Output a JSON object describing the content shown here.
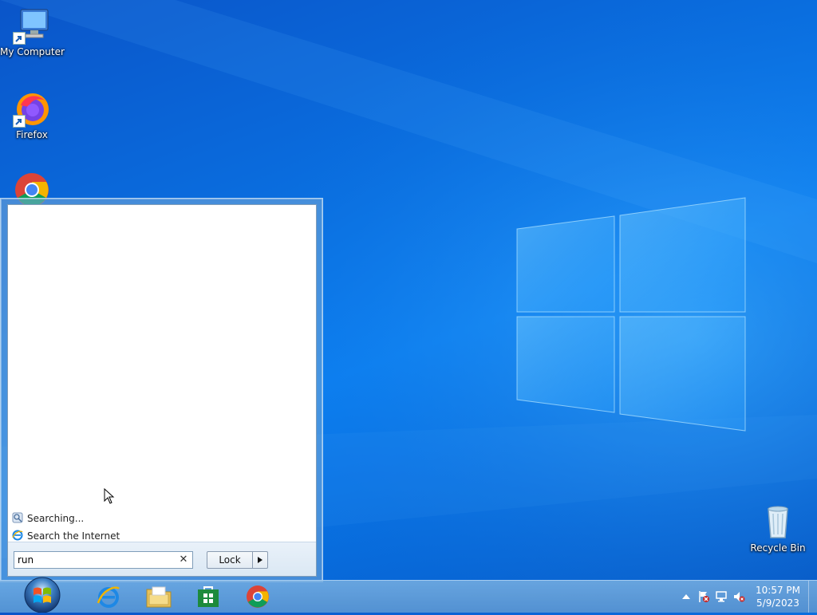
{
  "desktop": {
    "icons": [
      {
        "label": "My Computer",
        "icon": "computer-icon"
      },
      {
        "label": "Firefox",
        "icon": "firefox-icon"
      },
      {
        "label": "Google Chrome",
        "icon": "chrome-icon"
      },
      {
        "label": "Recycle Bin",
        "icon": "recycle-bin-icon"
      }
    ]
  },
  "start_menu": {
    "results": [
      {
        "label": "Searching...",
        "icon": "search-status-icon"
      },
      {
        "label": "Search the Internet",
        "icon": "internet-explorer-icon"
      }
    ],
    "search": {
      "value": "run",
      "clear_glyph": "✕"
    },
    "lock_button": {
      "label": "Lock"
    }
  },
  "taskbar": {
    "start_button": "start-orb",
    "pinned": [
      {
        "name": "Internet Explorer",
        "icon": "ie-icon"
      },
      {
        "name": "File Explorer",
        "icon": "folder-icon"
      },
      {
        "name": "Store",
        "icon": "store-icon"
      },
      {
        "name": "Google Chrome",
        "icon": "chrome-icon"
      }
    ],
    "tray": {
      "time": "10:57 PM",
      "date": "5/9/2023"
    }
  },
  "colors": {
    "wallpaper": "#0a6fe0",
    "accent": "#1e3287"
  }
}
